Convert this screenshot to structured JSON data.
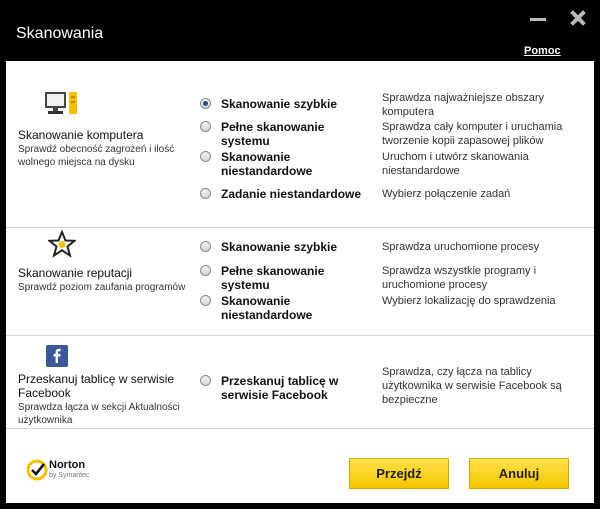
{
  "window": {
    "title": "Skanowania",
    "help_link": "Pomoc"
  },
  "sections": [
    {
      "title": "Skanowanie komputera",
      "description": "Sprawdź obecność zagrożeń i ilość wolnego miejsca na dysku",
      "icon": "computer-icon",
      "options": [
        {
          "label": "Skanowanie szybkie",
          "desc": "Sprawdza najważniejsze obszary komputera",
          "checked": true
        },
        {
          "label": "Pełne skanowanie systemu",
          "desc": "Sprawdza cały komputer i uruchamia tworzenie kopii zapasowej plików",
          "checked": false
        },
        {
          "label": "Skanowanie niestandardowe",
          "desc": "Uruchom i utwórz skanowania niestandardowe",
          "checked": false
        },
        {
          "label": "Zadanie niestandardowe",
          "desc": "Wybierz połączenie zadań",
          "checked": false
        }
      ]
    },
    {
      "title": "Skanowanie reputacji",
      "description": "Sprawdź poziom zaufania programów",
      "icon": "star-icon",
      "options": [
        {
          "label": "Skanowanie szybkie",
          "desc": "Sprawdza uruchomione procesy",
          "checked": false
        },
        {
          "label": "Pełne skanowanie systemu",
          "desc": "Sprawdza wszystkie programy i uruchomione procesy",
          "checked": false
        },
        {
          "label": "Skanowanie niestandardowe",
          "desc": "Wybierz lokalizację do sprawdzenia",
          "checked": false
        }
      ]
    },
    {
      "title": "Przeskanuj tablicę w serwisie Facebook",
      "description": "Sprawdza łącza w sekcji Aktualności użytkownika",
      "icon": "facebook-icon",
      "options": [
        {
          "label": "Przeskanuj tablicę w serwisie Facebook",
          "desc": "Sprawdza, czy łącza na tablicy użytkownika w serwisie Facebook są bezpieczne",
          "checked": false
        }
      ]
    }
  ],
  "footer": {
    "logo_text": "Norton",
    "logo_subtext": "by Symantec",
    "go_label": "Przejdź",
    "cancel_label": "Anuluj"
  },
  "colors": {
    "accent": "#f4c400",
    "titlebar": "#000000",
    "facebook": "#3b5998"
  }
}
